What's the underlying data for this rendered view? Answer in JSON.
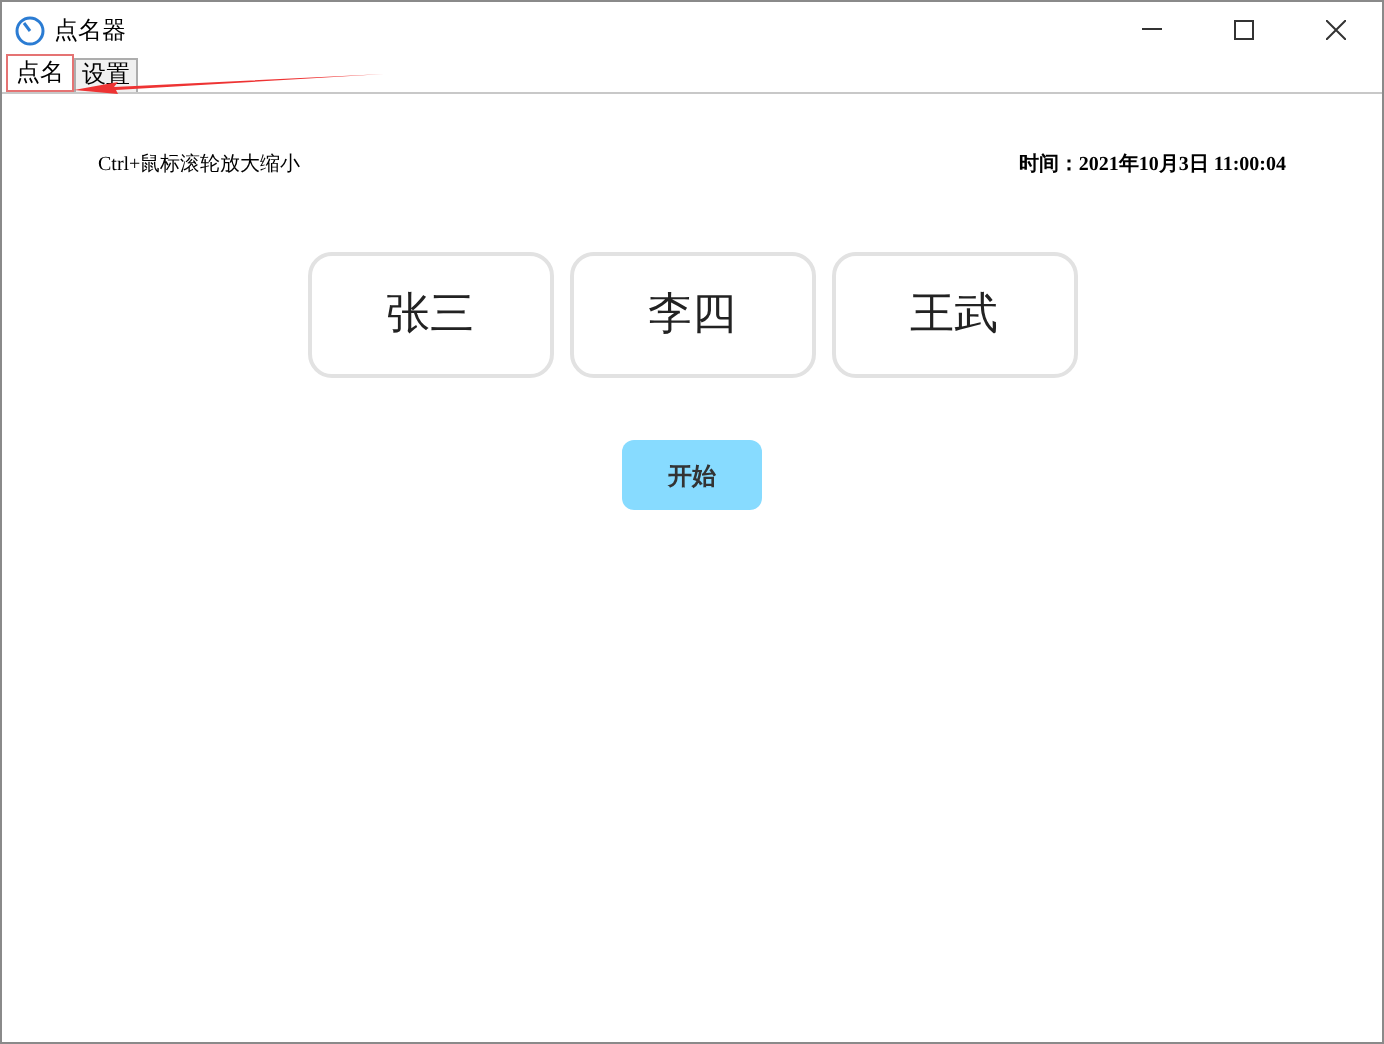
{
  "window": {
    "title": "点名器"
  },
  "tabs": [
    {
      "label": "点名",
      "selected": true
    },
    {
      "label": "设置",
      "selected": false
    }
  ],
  "hint": "Ctrl+鼠标滚轮放大缩小",
  "time": "时间：2021年10月3日 11:00:04",
  "names": [
    "张三",
    "李四",
    "王武"
  ],
  "start_button": "开始"
}
